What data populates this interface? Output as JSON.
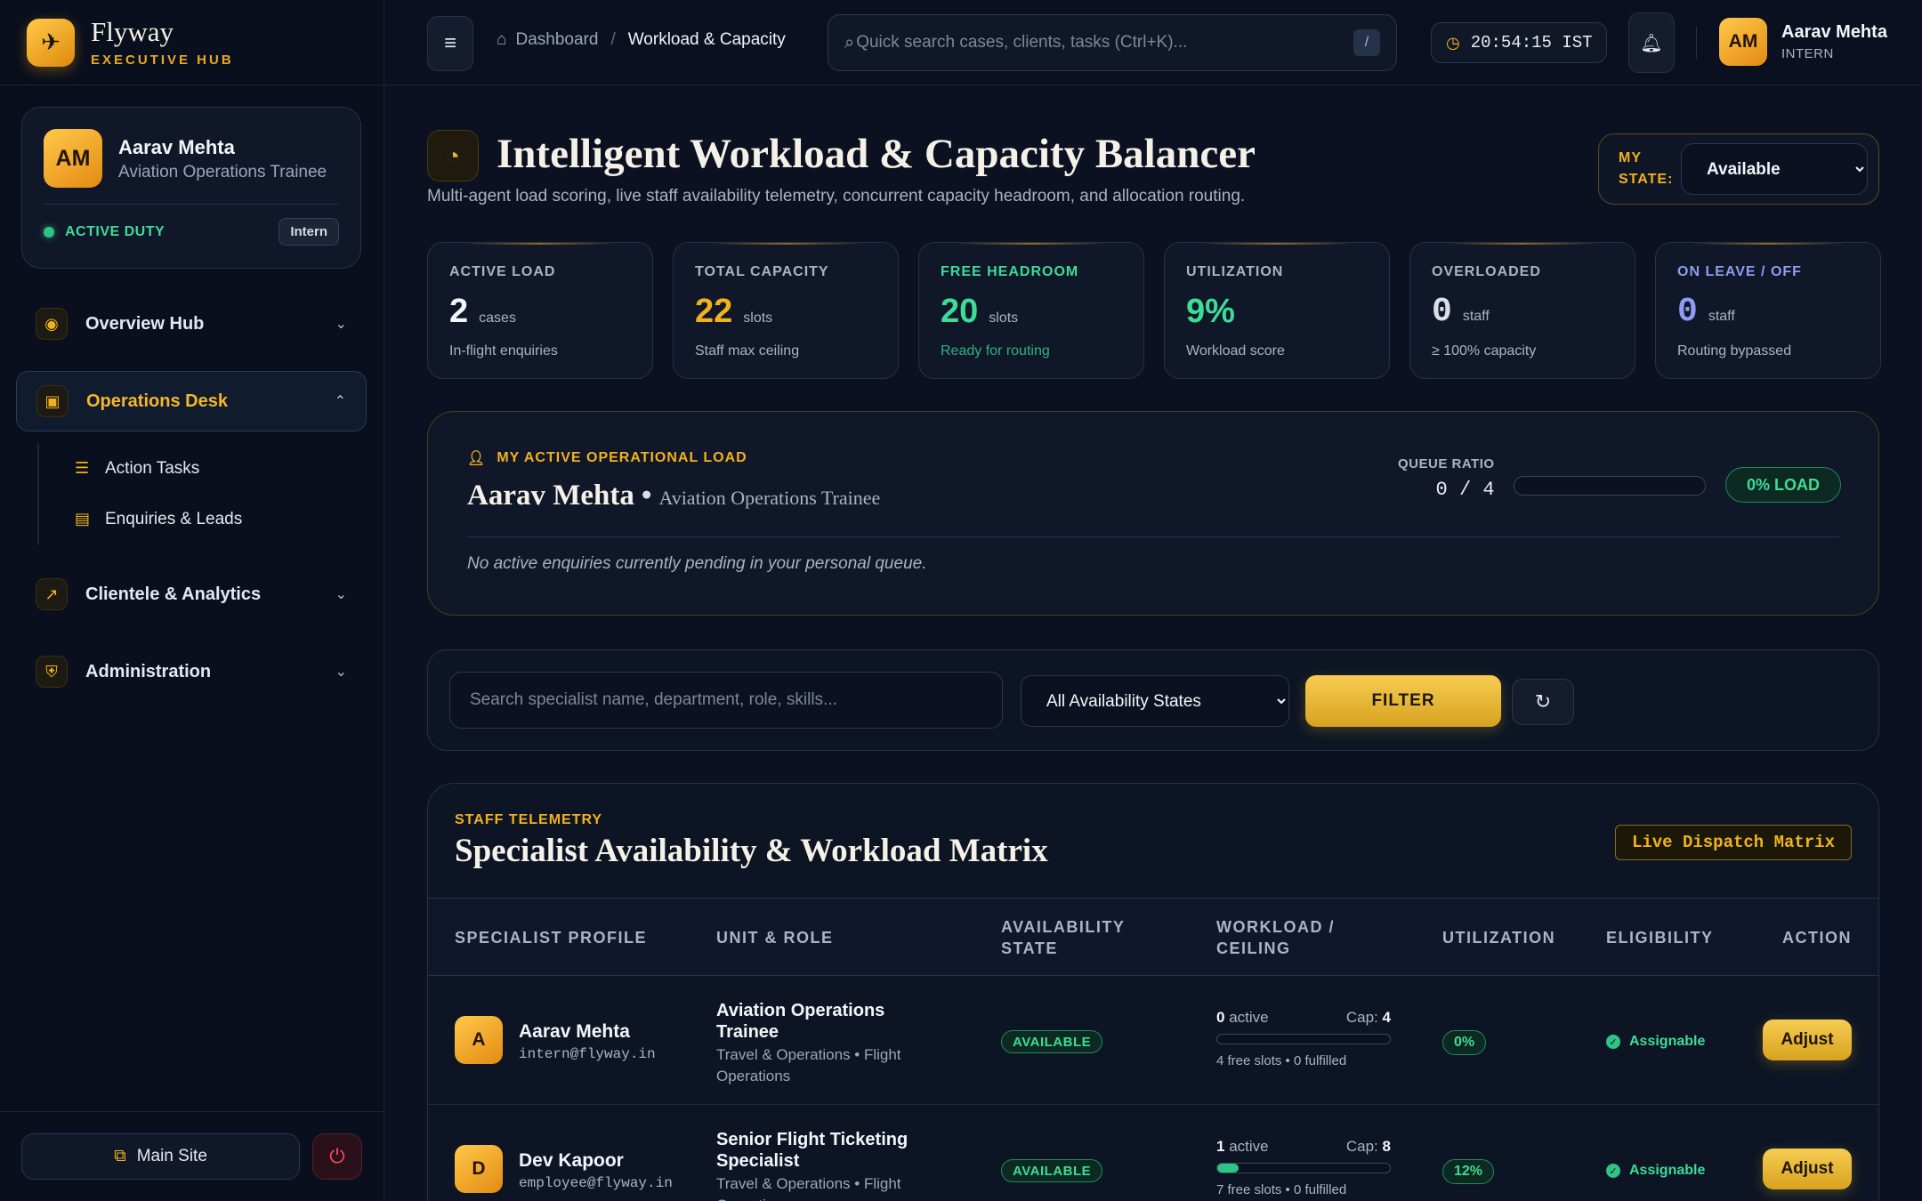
{
  "brand": {
    "name": "Flyway",
    "subtitle": "EXECUTIVE HUB"
  },
  "sidebar": {
    "profile": {
      "initials": "AM",
      "name": "Aarav Mehta",
      "role": "Aviation Operations Trainee",
      "status": "ACTIVE DUTY",
      "badge": "Intern"
    },
    "nav": [
      {
        "label": "Overview Hub",
        "icon": "compass-icon",
        "expanded": false
      },
      {
        "label": "Operations Desk",
        "icon": "briefcase-icon",
        "expanded": true,
        "children": [
          {
            "label": "Action Tasks",
            "icon": "list-check-icon"
          },
          {
            "label": "Enquiries & Leads",
            "icon": "inbox-icon"
          }
        ]
      },
      {
        "label": "Clientele & Analytics",
        "icon": "chart-line-icon",
        "expanded": false
      },
      {
        "label": "Administration",
        "icon": "shield-icon",
        "expanded": false
      }
    ],
    "footer": {
      "main_site": "Main Site"
    }
  },
  "topbar": {
    "breadcrumb": [
      "Dashboard",
      "Workload & Capacity"
    ],
    "search_placeholder": "Quick search cases, clients, tasks (Ctrl+K)...",
    "search_shortcut": "/",
    "clock": "20:54:15 IST",
    "user": {
      "initials": "AM",
      "name": "Aarav Mehta",
      "role": "INTERN"
    }
  },
  "page": {
    "title": "Intelligent Workload & Capacity Balancer",
    "subtitle": "Multi-agent load scoring, live staff availability telemetry, concurrent capacity headroom, and allocation routing.",
    "my_state": {
      "label": "MY STATE:",
      "value": "Available"
    }
  },
  "stats": [
    {
      "label": "ACTIVE LOAD",
      "value": "2",
      "unit": "cases",
      "desc": "In-flight enquiries"
    },
    {
      "label": "TOTAL CAPACITY",
      "value": "22",
      "unit": "slots",
      "desc": "Staff max ceiling"
    },
    {
      "label": "FREE HEADROOM",
      "value": "20",
      "unit": "slots",
      "desc": "Ready for routing"
    },
    {
      "label": "UTILIZATION",
      "value": "9%",
      "unit": "",
      "desc": "Workload score"
    },
    {
      "label": "OVERLOADED",
      "value": "0",
      "unit": "staff",
      "desc": "≥ 100% capacity"
    },
    {
      "label": "ON LEAVE / OFF",
      "value": "0",
      "unit": "staff",
      "desc": "Routing bypassed"
    }
  ],
  "my_load": {
    "tag": "MY ACTIVE OPERATIONAL LOAD",
    "name": "Aarav Mehta",
    "role": "Aviation Operations Trainee",
    "queue_label": "QUEUE RATIO",
    "queue_value": "0 / 4",
    "queue_fraction": 0,
    "load_pill": "0% LOAD",
    "empty_text": "No active enquiries currently pending in your personal queue."
  },
  "filters": {
    "search_placeholder": "Search specialist name, department, role, skills...",
    "availability": "All Availability States",
    "filter_button": "FILTER"
  },
  "matrix": {
    "tag": "STAFF TELEMETRY",
    "title": "Specialist Availability & Workload Matrix",
    "badge": "Live Dispatch Matrix",
    "columns": [
      "SPECIALIST PROFILE",
      "UNIT & ROLE",
      "AVAILABILITY STATE",
      "WORKLOAD / CEILING",
      "UTILIZATION",
      "ELIGIBILITY",
      "ACTION"
    ],
    "rows": [
      {
        "initial": "A",
        "name": "Aarav Mehta",
        "email": "intern@flyway.in",
        "role": "Aviation Operations Trainee",
        "dept": "Travel & Operations • Flight Operations",
        "availability": "AVAILABLE",
        "active": "0",
        "active_label": "active",
        "cap_label": "Cap:",
        "cap": "4",
        "load_fraction": 0,
        "slots_text": "4 free slots • 0 fulfilled",
        "utilization": "0%",
        "eligibility": "Assignable",
        "action": "Adjust"
      },
      {
        "initial": "D",
        "name": "Dev Kapoor",
        "email": "employee@flyway.in",
        "role": "Senior Flight Ticketing Specialist",
        "dept": "Travel & Operations • Flight Operations",
        "availability": "AVAILABLE",
        "active": "1",
        "active_label": "active",
        "cap_label": "Cap:",
        "cap": "8",
        "load_fraction": 0.125,
        "slots_text": "7 free slots • 0 fulfilled",
        "utilization": "12%",
        "eligibility": "Assignable",
        "action": "Adjust"
      }
    ]
  }
}
